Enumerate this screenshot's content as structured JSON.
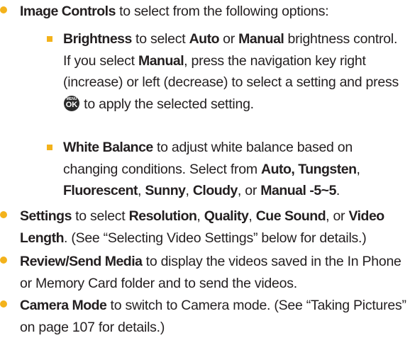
{
  "items": {
    "image_controls": {
      "term": "Image Controls",
      "text": " to select from the following options:"
    },
    "brightness": {
      "term": "Brightness",
      "t1": " to select ",
      "auto": "Auto",
      "t2": " or ",
      "manual": "Manual",
      "t3": " brightness control. If you select ",
      "manual2": "Manual",
      "t4": ", press the navigation key right (increase) or left (decrease) to select a setting and press ",
      "t5": " to apply the selected setting."
    },
    "white_balance": {
      "term": "White Balance",
      "t1": " to adjust white balance based on changing conditions. Select from ",
      "opt1": "Auto, Tungsten",
      "c1": ", ",
      "opt2": "Fluorescent",
      "c2": ", ",
      "opt3": "Sunny",
      "c3": ", ",
      "opt4": "Cloudy",
      "c4": ", or ",
      "opt5": "Manual -5~5",
      "end": "."
    },
    "settings": {
      "term": "Settings",
      "t1": " to select ",
      "opt1": "Resolution",
      "c1": ", ",
      "opt2": "Quality",
      "c2": ", ",
      "opt3": "Cue Sound",
      "c3": ", or ",
      "opt4": "Video Length",
      "t2": ". (See “Selecting Video Settings” below for details.)"
    },
    "review_send": {
      "term": "Review/Send Media",
      "text": " to display the videos saved in the In Phone or Memory Card folder and to send the videos."
    },
    "camera_mode": {
      "term": "Camera Mode",
      "text": " to switch to Camera mode. (See “Taking Pictures” on page 107 for details.)"
    }
  },
  "ok_key": {
    "top": "MENU",
    "main": "OK"
  },
  "colors": {
    "bullet": "#f3b21b",
    "text": "#231f20",
    "key": "#2b2b2b"
  }
}
